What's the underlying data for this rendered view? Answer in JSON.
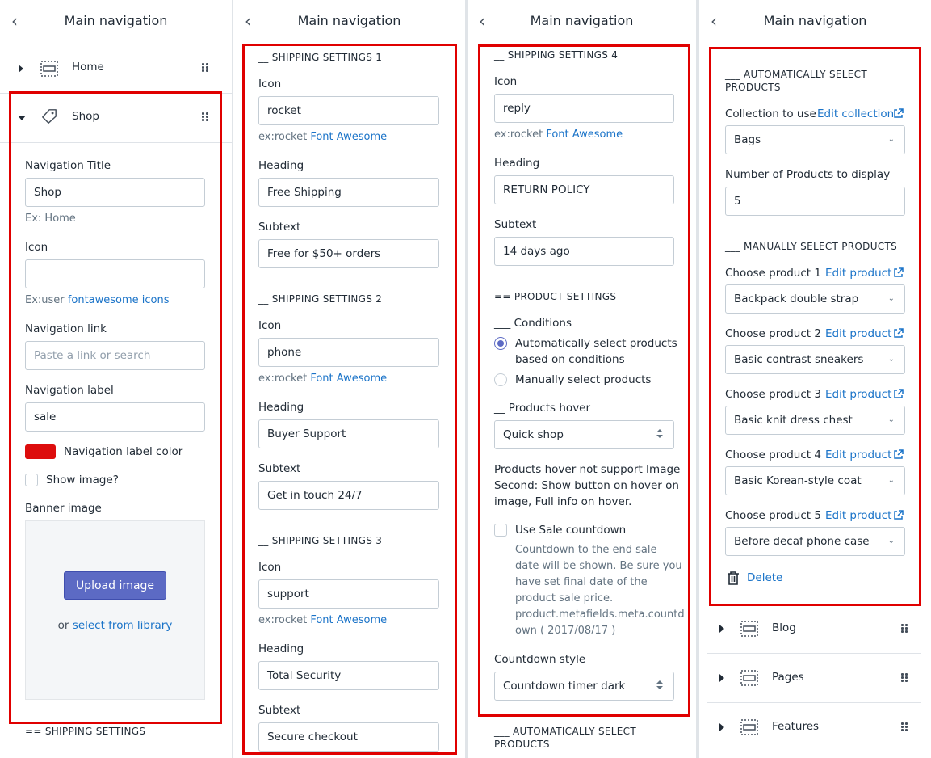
{
  "header": {
    "title": "Main navigation"
  },
  "col1": {
    "nav_home": "Home",
    "nav_shop": "Shop",
    "nav_title_label": "Navigation Title",
    "nav_title_value": "Shop",
    "nav_title_hint": "Ex: Home",
    "icon_label": "Icon",
    "icon_value": "",
    "icon_hint_prefix": "Ex:user",
    "icon_hint_link": "fontawesome icons",
    "link_label": "Navigation link",
    "link_placeholder": "Paste a link or search",
    "nav_label_label": "Navigation label",
    "nav_label_value": "sale",
    "label_color_label": "Navigation label color",
    "label_color": "#dd0d0d",
    "show_image_label": "Show image?",
    "banner_label": "Banner image",
    "upload_button": "Upload image",
    "library_prefix": "or",
    "library_link": "select from library",
    "shipping_heading": "== SHIPPING SETTINGS"
  },
  "col2": {
    "groups": [
      {
        "title": "__ SHIPPING SETTINGS 1",
        "icon_label": "Icon",
        "icon_value": "rocket",
        "hint_prefix": "ex:rocket",
        "hint_link": "Font Awesome",
        "heading_label": "Heading",
        "heading_value": "Free Shipping",
        "subtext_label": "Subtext",
        "subtext_value": "Free for $50+ orders"
      },
      {
        "title": "__ SHIPPING SETTINGS 2",
        "icon_label": "Icon",
        "icon_value": "phone",
        "hint_prefix": "ex:rocket",
        "hint_link": "Font Awesome",
        "heading_label": "Heading",
        "heading_value": "Buyer Support",
        "subtext_label": "Subtext",
        "subtext_value": "Get in touch 24/7"
      },
      {
        "title": "__ SHIPPING SETTINGS 3",
        "icon_label": "Icon",
        "icon_value": "support",
        "hint_prefix": "ex:rocket",
        "hint_link": "Font Awesome",
        "heading_label": "Heading",
        "heading_value": "Total Security",
        "subtext_label": "Subtext",
        "subtext_value": "Secure checkout"
      }
    ]
  },
  "col3": {
    "title": "__ SHIPPING SETTINGS 4",
    "icon_label": "Icon",
    "icon_value": "reply",
    "hint_prefix": "ex:rocket",
    "hint_link": "Font Awesome",
    "heading_label": "Heading",
    "heading_value": "RETURN POLICY",
    "subtext_label": "Subtext",
    "subtext_value": "14 days ago",
    "product_settings": "== PRODUCT SETTINGS",
    "conditions": "___ Conditions",
    "radio_auto_line1": "Automatically select products",
    "radio_auto_line2": "based on conditions",
    "radio_manual": "Manually select products",
    "hover_label": "__ Products hover",
    "hover_value": "Quick shop",
    "hover_note_1": "Products hover not support Image",
    "hover_note_2": "Second: Show button on hover on",
    "hover_note_3": "image, Full info on hover.",
    "sale_countdown_label": "Use Sale countdown",
    "countdown_help": [
      "Countdown to the end sale",
      "date will be shown. Be sure you",
      "have set final date of the",
      "product sale price.",
      "product.metafields.meta.countd",
      "own ( 2017/08/17 )"
    ],
    "countdown_style_label": "Countdown style",
    "countdown_style_value": "Countdown timer dark",
    "auto_select_line1": "___ AUTOMATICALLY SELECT",
    "auto_select_line2": "PRODUCTS"
  },
  "col4": {
    "auto_line1": "___ AUTOMATICALLY SELECT",
    "auto_line2": "PRODUCTS",
    "collection_label": "Collection to use",
    "edit_collection": "Edit collection",
    "collection_value": "Bags",
    "num_label": "Number of Products to display",
    "num_value": "5",
    "manual_heading": "___ MANUALLY SELECT PRODUCTS",
    "edit_product": "Edit product",
    "products": [
      {
        "label": "Choose product 1",
        "value": "Backpack double strap"
      },
      {
        "label": "Choose product 2",
        "value": "Basic contrast sneakers"
      },
      {
        "label": "Choose product 3",
        "value": "Basic knit dress chest"
      },
      {
        "label": "Choose product 4",
        "value": "Basic Korean-style coat"
      },
      {
        "label": "Choose product 5",
        "value": "Before decaf phone case"
      }
    ],
    "delete": "Delete",
    "nav_items": [
      "Blog",
      "Pages",
      "Features"
    ]
  }
}
